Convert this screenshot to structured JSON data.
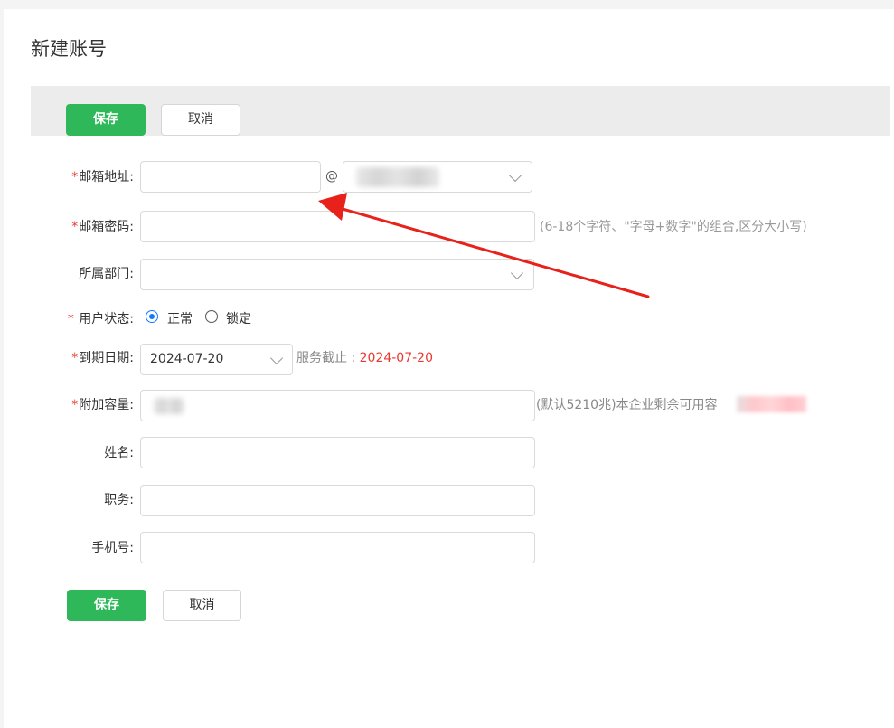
{
  "page": {
    "title": "新建账号"
  },
  "toolbar": {
    "save_label": "保存",
    "cancel_label": "取消"
  },
  "form": {
    "email": {
      "label": "邮箱地址:",
      "value": "",
      "at": "@",
      "domain_value": ""
    },
    "password": {
      "label": "邮箱密码:",
      "value": "",
      "hint": "(6-18个字符、\"字母+数字\"的组合,区分大小写)"
    },
    "department": {
      "label": "所属部门:",
      "value": ""
    },
    "status": {
      "label": "用户状态:",
      "options": [
        "正常",
        "锁定"
      ],
      "selected": "正常"
    },
    "expiry": {
      "label": "到期日期:",
      "value": "2024-07-20",
      "service_label": "服务截止 : ",
      "service_date": "2024-07-20"
    },
    "capacity": {
      "label": "附加容量:",
      "value": "",
      "hint": "(默认5210兆)本企业剩余可用容"
    },
    "name": {
      "label": "姓名:",
      "value": ""
    },
    "position": {
      "label": "职务:",
      "value": ""
    },
    "phone": {
      "label": "手机号:",
      "value": ""
    },
    "required_mark": "*"
  },
  "footer": {
    "save_label": "保存",
    "cancel_label": "取消"
  },
  "colors": {
    "primary": "#2fb85a",
    "required": "#e8382f",
    "radio": "#1677ff",
    "annotation_arrow": "#e8221b"
  }
}
